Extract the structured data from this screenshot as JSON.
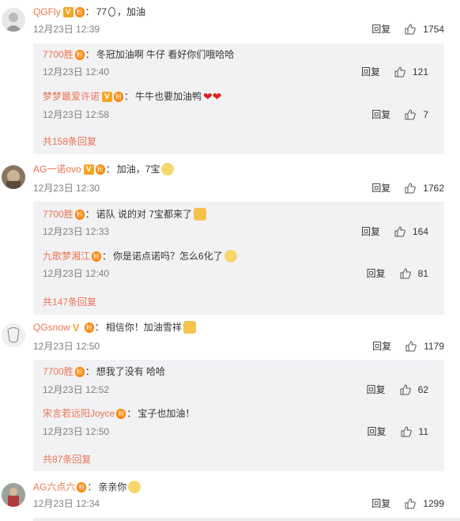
{
  "comments": [
    {
      "user": "QGFly",
      "text": "77",
      "text_after": "，加油",
      "date": "12月23日 12:39",
      "reply_label": "回复",
      "likes": "1754",
      "subs": [
        {
          "user": "7700胜",
          "text": "冬冠加油啊 牛仔 看好你们哦哈哈",
          "date": "12月23日 12:40",
          "reply_label": "回复",
          "likes": "121"
        },
        {
          "user": "梦梦最爱许诺",
          "text": "牛牛也要加油鸭",
          "date": "12月23日 12:58",
          "reply_label": "回复",
          "likes": "7"
        }
      ],
      "more": "共158条回复"
    },
    {
      "user": "AG一诺ovo",
      "text": "加油，7宝",
      "date": "12月23日 12:30",
      "reply_label": "回复",
      "likes": "1762",
      "subs": [
        {
          "user": "7700胜",
          "text": "诺队 说的对 7宝都来了",
          "date": "12月23日 12:33",
          "reply_label": "回复",
          "likes": "164"
        },
        {
          "user": "九歌梦湘江",
          "text": "你是诺点诺吗？怎么6化了",
          "date": "12月23日 12:40",
          "reply_label": "回复",
          "likes": "81"
        }
      ],
      "more": "共147条回复"
    },
    {
      "user": "QGsnow",
      "text": "相信你！加油雪祥",
      "date": "12月23日 12:50",
      "reply_label": "回复",
      "likes": "1179",
      "subs": [
        {
          "user": "7700胜",
          "text": "想我了没有 哈哈",
          "date": "12月23日 12:52",
          "reply_label": "回复",
          "likes": "62"
        },
        {
          "user": "宋言若远阳Joyce",
          "text": "宝子也加油！",
          "date": "12月23日 12:50",
          "reply_label": "回复",
          "likes": "11"
        }
      ],
      "more": "共87条回复"
    },
    {
      "user": "AG六点六",
      "text": "亲亲你",
      "date": "12月23日 12:34",
      "reply_label": "回复",
      "likes": "1299"
    }
  ],
  "colors": {
    "username": "#eb7350",
    "sub_bg": "#f2f2f5",
    "meta": "#808080"
  }
}
